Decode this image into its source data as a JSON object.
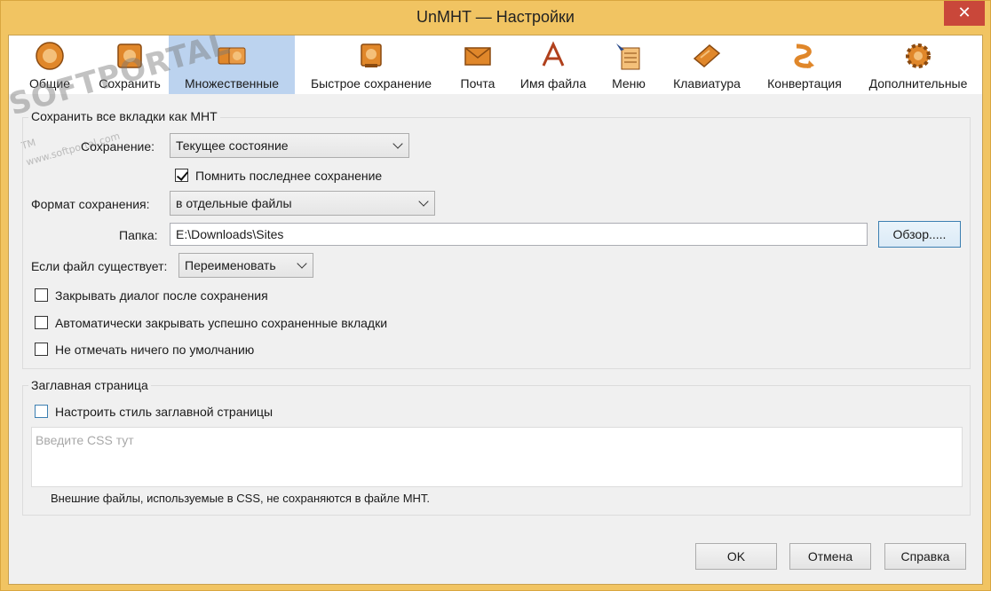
{
  "window": {
    "title": "UnMHT — Настройки",
    "close_glyph": "✕"
  },
  "watermark": {
    "text": "SOFTPORTAL",
    "sub": "www.softportal.com",
    "tm": "TM"
  },
  "tabs": [
    {
      "label": "Общие",
      "icon": "general-icon"
    },
    {
      "label": "Сохранить",
      "icon": "save-icon"
    },
    {
      "label": "Множественные",
      "icon": "multiple-icon"
    },
    {
      "label": "Быстрое сохранение",
      "icon": "quick-save-icon"
    },
    {
      "label": "Почта",
      "icon": "mail-icon"
    },
    {
      "label": "Имя файла",
      "icon": "filename-icon"
    },
    {
      "label": "Меню",
      "icon": "menu-icon"
    },
    {
      "label": "Клавиатура",
      "icon": "keyboard-icon"
    },
    {
      "label": "Конвертация",
      "icon": "convert-icon"
    },
    {
      "label": "Дополнительные",
      "icon": "advanced-icon"
    }
  ],
  "active_tab": "Множественные",
  "save_all": {
    "legend": "Сохранить все вкладки как MHT",
    "save_label": "Сохранение:",
    "save_value": "Текущее состояние",
    "remember_label": "Помнить последнее сохранение",
    "remember_checked": true,
    "format_label": "Формат сохранения:",
    "format_value": "в отдельные файлы",
    "folder_label": "Папка:",
    "folder_value": "E:\\Downloads\\Sites",
    "browse_label": "Обзор.....",
    "exists_label": "Если файл существует:",
    "exists_value": "Переименовать",
    "close_dialog_label": "Закрывать диалог после сохранения",
    "close_dialog_checked": false,
    "auto_close_label": "Автоматически закрывать успешно сохраненные вкладки",
    "auto_close_checked": false,
    "no_default_label": "Не отмечать ничего по умолчанию",
    "no_default_checked": false
  },
  "title_page": {
    "legend": "Заглавная страница",
    "customize_label": "Настроить стиль заглавной страницы",
    "customize_checked": false,
    "css_placeholder": "Введите CSS тут",
    "note": "Внешние файлы, используемые в CSS, не сохраняются в файле MHT."
  },
  "footer": {
    "ok_label": "OK",
    "cancel_label": "Отмена",
    "help_label": "Справка"
  },
  "colors": {
    "title_bar": "#f1c462",
    "active_tab": "#bcd3ef",
    "close_button": "#c9473a",
    "icon_orange": "#e0872a"
  }
}
